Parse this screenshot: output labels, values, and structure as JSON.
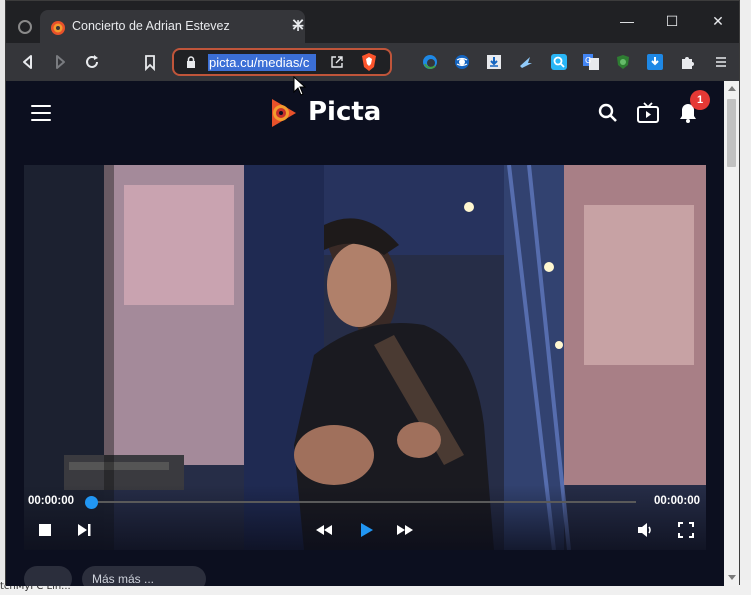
{
  "browser": {
    "tab_title": "Concierto de Adrian Estevez",
    "new_tab_symbol": "+",
    "url": "picta.cu/medias/c",
    "window_controls": {
      "minimize": "—",
      "maximize": "☐",
      "close": "✕"
    },
    "icons": [
      "back-icon",
      "forward-icon",
      "reload-icon",
      "bookmark-icon",
      "lock-icon",
      "open-external-icon",
      "brave-shield-icon",
      "edge-icon",
      "globe-icon",
      "download-icon",
      "arrow-icon",
      "search-ext-icon",
      "translate-icon",
      "shield-ext-icon",
      "download-ext-icon",
      "extensions-puzzle-icon",
      "menu-icon"
    ]
  },
  "site": {
    "logo_text": "Picta",
    "notification_count": "1",
    "icons": [
      "hamburger-menu-icon",
      "search-icon",
      "tv-icon",
      "bell-icon"
    ]
  },
  "player": {
    "current_time": "00:00:00",
    "duration": "00:00:00",
    "progress": 0.0,
    "controls": [
      "stop-icon",
      "skip-next-icon",
      "rewind-icon",
      "play-icon",
      "fast-forward-icon",
      "volume-icon",
      "fullscreen-icon"
    ]
  },
  "chips": [
    "",
    "Más más ... "
  ],
  "desktop": {
    "bottom_text": "tchMyPC Lin..."
  },
  "colors": {
    "accent": "#2196f3",
    "page_bg": "#0c0f1f",
    "badge": "#e53935",
    "omnibox_border": "#c0553a"
  }
}
